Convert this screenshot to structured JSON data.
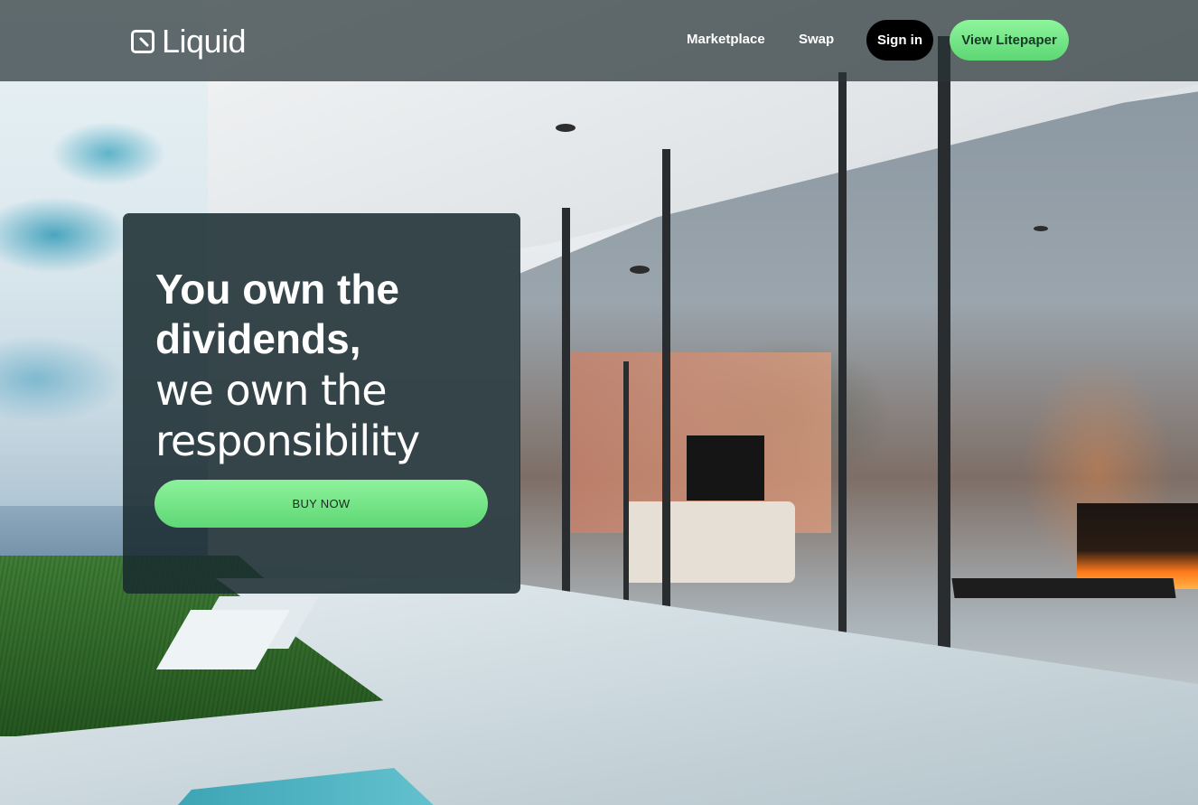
{
  "header": {
    "logo_text": "Liquid",
    "logo_icon": "liquid-logo-icon",
    "nav": {
      "marketplace_label": "Marketplace",
      "swap_label": "Swap",
      "signin_label": "Sign in",
      "litepaper_label": "View Litepaper"
    }
  },
  "hero": {
    "title_line1": "You own the",
    "title_line2": "dividends,",
    "subtitle_line1": "we own the",
    "subtitle_line2": "responsibility",
    "cta_label": "BUY NOW"
  },
  "colors": {
    "accent_green": "#6ee883",
    "header_bg": "#283438",
    "card_bg": "#182a2f",
    "signin_bg": "#000000"
  }
}
